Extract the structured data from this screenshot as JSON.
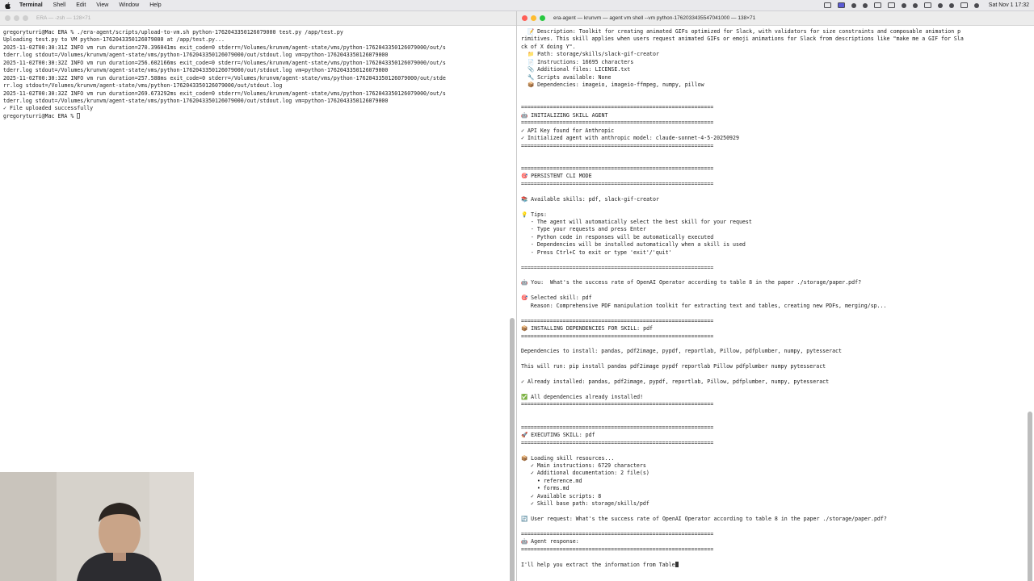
{
  "menubar": {
    "items": [
      "Terminal",
      "Shell",
      "Edit",
      "View",
      "Window",
      "Help"
    ],
    "clock": "Sat Nov 1  17:32"
  },
  "left_terminal": {
    "title": "ERA — -zsh — 128×71",
    "lines": [
      "gregoryturri@Mac ERA % ./era-agent/scripts/upload-to-vm.sh python-1762043350126079000 test.py /app/test.py",
      "Uploading test.py to VM python-1762043350126079000 at /app/test.py...",
      "2025-11-02T00:30:31Z INFO vm run duration=270.396041ms exit_code=0 stderr=/Volumes/krunvm/agent-state/vms/python-1762043350126079000/out/s",
      "tderr.log stdout=/Volumes/krunvm/agent-state/vms/python-1762043350126079000/out/stdout.log vm=python-1762043350126079000",
      "2025-11-02T00:30:32Z INFO vm run duration=256.602166ms exit_code=0 stderr=/Volumes/krunvm/agent-state/vms/python-1762043350126079000/out/s",
      "tderr.log stdout=/Volumes/krunvm/agent-state/vms/python-1762043350126079000/out/stdout.log vm=python-1762043350126079000",
      "2025-11-02T00:30:32Z INFO vm run duration=257.588ms exit_code=0 stderr=/Volumes/krunvm/agent-state/vms/python-1762043350126079000/out/stde",
      "rr.log stdout=/Volumes/krunvm/agent-state/vms/python-1762043350126079000/out/stdout.log",
      "2025-11-02T00:30:32Z INFO vm run duration=269.673292ms exit_code=0 stderr=/Volumes/krunvm/agent-state/vms/python-1762043350126079000/out/s",
      "tderr.log stdout=/Volumes/krunvm/agent-state/vms/python-1762043350126079000/out/stdout.log vm=python-1762043350126079000",
      "✓ File uploaded successfully"
    ],
    "prompt": "gregoryturri@Mac ERA % "
  },
  "right_terminal": {
    "title": "era-agent — krunvm — agent vm shell --vm python-1762033435547041000 — 138×71",
    "lines": [
      "  📝 Description: Toolkit for creating animated GIFs optimized for Slack, with validators for size constraints and composable animation p",
      "rimitives. This skill applies when users request animated GIFs or emoji animations for Slack from descriptions like \"make me a GIF for Sla",
      "ck of X doing Y\".",
      "  📁 Path: storage/skills/slack-gif-creator",
      "  📄 Instructions: 16695 characters",
      "  📎 Additional files: LICENSE.txt",
      "  🔧 Scripts available: None",
      "  📦 Dependencies: imageio, imageio-ffmpeg, numpy, pillow",
      "",
      "",
      "============================================================",
      "🤖 INITIALIZING SKILL AGENT",
      "============================================================",
      "✓ API Key found for Anthropic",
      "✓ Initialized agent with anthropic model: claude-sonnet-4-5-20250929",
      "============================================================",
      "",
      "",
      "============================================================",
      "🎯 PERSISTENT CLI MODE",
      "============================================================",
      "",
      "📚 Available skills: pdf, slack-gif-creator",
      "",
      "💡 Tips:",
      "   - The agent will automatically select the best skill for your request",
      "   - Type your requests and press Enter",
      "   - Python code in responses will be automatically executed",
      "   - Dependencies will be installed automatically when a skill is used",
      "   - Press Ctrl+C to exit or type 'exit'/'quit'",
      "",
      "============================================================",
      "",
      "🤖 You:  What's the success rate of OpenAI Operator according to table 8 in the paper ./storage/paper.pdf?",
      "",
      "🎯 Selected skill: pdf",
      "   Reason: Comprehensive PDF manipulation toolkit for extracting text and tables, creating new PDFs, merging/sp...",
      "",
      "============================================================",
      "📦 INSTALLING DEPENDENCIES FOR SKILL: pdf",
      "============================================================",
      "",
      "Dependencies to install: pandas, pdf2image, pypdf, reportlab, Pillow, pdfplumber, numpy, pytesseract",
      "",
      "This will run: pip install pandas pdf2image pypdf reportlab Pillow pdfplumber numpy pytesseract",
      "",
      "✓ Already installed: pandas, pdf2image, pypdf, reportlab, Pillow, pdfplumber, numpy, pytesseract",
      "",
      "✅ All dependencies already installed!",
      "============================================================",
      "",
      "",
      "============================================================",
      "🚀 EXECUTING SKILL: pdf",
      "============================================================",
      "",
      "📦 Loading skill resources...",
      "   ✓ Main instructions: 6729 characters",
      "   ✓ Additional documentation: 2 file(s)",
      "     • reference.md",
      "     • forms.md",
      "   ✓ Available scripts: 8",
      "   ✓ Skill base path: storage/skills/pdf",
      "",
      "🔄 User request: What's the success rate of OpenAI Operator according to table 8 in the paper ./storage/paper.pdf?",
      "",
      "============================================================",
      "🤖 Agent response:",
      "============================================================",
      "",
      "I'll help you extract the information from Table"
    ]
  }
}
